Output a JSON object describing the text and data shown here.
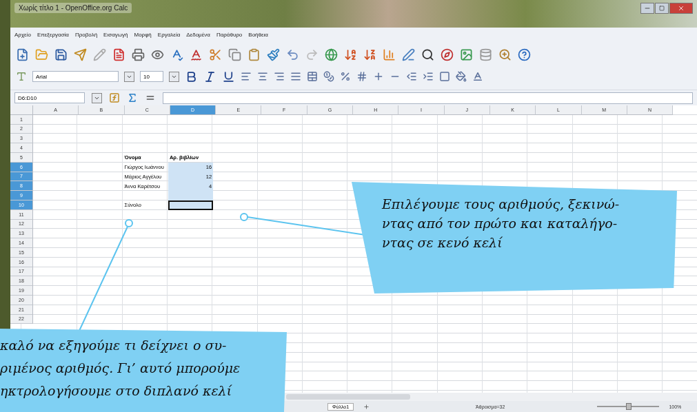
{
  "window": {
    "title": "Χωρίς τίτλο 1 - OpenOffice.org Calc"
  },
  "menu": [
    "Αρχείο",
    "Επεξεργασία",
    "Προβολή",
    "Εισαγωγή",
    "Μορφή",
    "Εργαλεία",
    "Δεδομένα",
    "Παράθυρο",
    "Βοήθεια"
  ],
  "format_bar": {
    "font": "Arial",
    "size": "10"
  },
  "formula_bar": {
    "name_box": "D6:D10"
  },
  "columns": [
    {
      "label": "A",
      "selected": false
    },
    {
      "label": "B",
      "selected": false
    },
    {
      "label": "C",
      "selected": false
    },
    {
      "label": "D",
      "selected": true
    },
    {
      "label": "E",
      "selected": false
    },
    {
      "label": "F",
      "selected": false
    },
    {
      "label": "G",
      "selected": false
    },
    {
      "label": "H",
      "selected": false
    },
    {
      "label": "I",
      "selected": false
    },
    {
      "label": "J",
      "selected": false
    },
    {
      "label": "K",
      "selected": false
    },
    {
      "label": "L",
      "selected": false
    },
    {
      "label": "M",
      "selected": false
    },
    {
      "label": "N",
      "selected": false
    }
  ],
  "rows": [
    {
      "label": "1",
      "selected": false
    },
    {
      "label": "2",
      "selected": false
    },
    {
      "label": "3",
      "selected": false
    },
    {
      "label": "4",
      "selected": false
    },
    {
      "label": "5",
      "selected": false,
      "kind": "header",
      "name_cell": "Όνομα",
      "count_cell": "Αρ. βιβλίων"
    },
    {
      "label": "6",
      "selected": true,
      "kind": "data",
      "name_cell": "Γιώργος Ιωάννου",
      "count_cell": "16"
    },
    {
      "label": "7",
      "selected": true,
      "kind": "data",
      "name_cell": "Μάριος Αγγέλου",
      "count_cell": "12"
    },
    {
      "label": "8",
      "selected": true,
      "kind": "data",
      "name_cell": "Άννα Καρέτσου",
      "count_cell": "4"
    },
    {
      "label": "9",
      "selected": true
    },
    {
      "label": "10",
      "selected": true,
      "kind": "data",
      "name_cell": "Σύνολο",
      "active_cell": true
    },
    {
      "label": "11",
      "selected": false
    },
    {
      "label": "12",
      "selected": false
    },
    {
      "label": "13",
      "selected": false
    },
    {
      "label": "14",
      "selected": false
    },
    {
      "label": "15",
      "selected": false
    },
    {
      "label": "16",
      "selected": false
    },
    {
      "label": "17",
      "selected": false
    },
    {
      "label": "18",
      "selected": false
    },
    {
      "label": "19",
      "selected": false
    },
    {
      "label": "20",
      "selected": false
    },
    {
      "label": "21",
      "selected": false
    },
    {
      "label": "22",
      "selected": false
    }
  ],
  "status_bar": {
    "sheet_tab": "Φύλλο1",
    "sum": "Άθροισμα=32",
    "zoom": "100%",
    "zoom_slider": {
      "level": 0.5
    }
  },
  "callouts": [
    {
      "lines": [
        "Επιλέγουμε τους αριθμούς, ξεκινώ-",
        "ντας από τον πρώτο και καταλήγο-",
        "ντας σε κενό κελί"
      ]
    },
    {
      "lines": [
        "καλό να εξηγούμε τι δείχνει ο συ-",
        "ριμένος αριθμός. Γι’ αυτό μπορούμε",
        "ηκτρολογήσουμε στο διπλανό κελί"
      ]
    }
  ]
}
